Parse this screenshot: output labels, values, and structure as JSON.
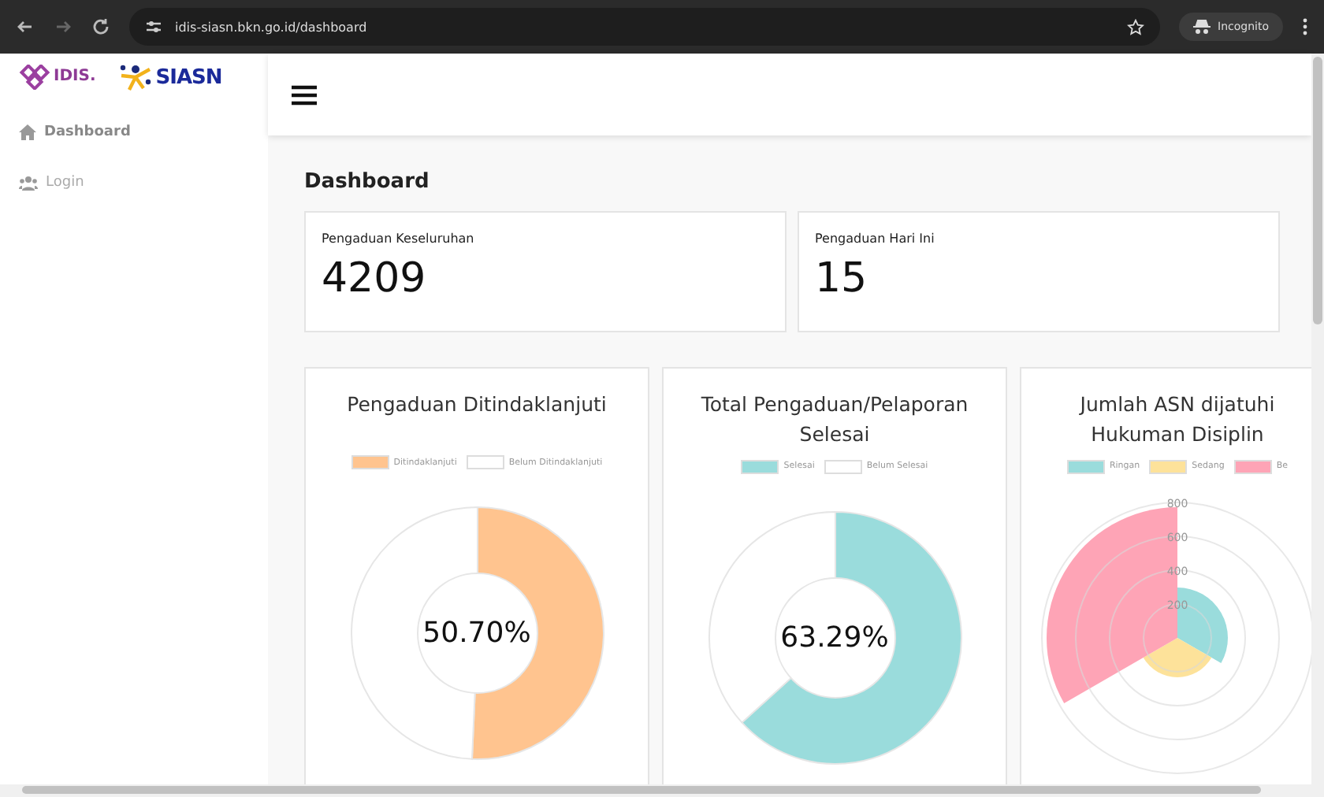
{
  "browser": {
    "url": "idis-siasn.bkn.go.id/dashboard",
    "profile": "Incognito"
  },
  "sidebar": {
    "logos": [
      {
        "text": "IDIS."
      },
      {
        "text": "SIASN"
      }
    ],
    "items": [
      {
        "label": "Dashboard",
        "selected": true
      },
      {
        "label": "Login",
        "selected": false
      }
    ]
  },
  "page_title": "Dashboard",
  "stats": [
    {
      "label": "Pengaduan Keseluruhan",
      "value": "4209"
    },
    {
      "label": "Pengaduan Hari Ini",
      "value": "15"
    }
  ],
  "charts": [
    {
      "title": "Pengaduan Ditindaklanjuti",
      "center": "50.70%",
      "chart_data": {
        "type": "donut",
        "legend": "top",
        "categories": [
          "Ditindaklanjuti",
          "Belum Ditindaklanjuti"
        ],
        "values": [
          50.7,
          49.3
        ]
      }
    },
    {
      "title": "Total Pengaduan/Pelaporan Selesai",
      "center": "63.29%",
      "chart_data": {
        "type": "donut",
        "legend": "top",
        "categories": [
          "Selesai",
          "Belum Selesai"
        ],
        "values": [
          63.29,
          36.71
        ]
      }
    }
  ],
  "polar_chart": {
    "title": "Jumlah ASN dijatuhi Hukuman Disiplin",
    "legend": [
      {
        "label": "Ringan",
        "color": "#9adcdc"
      },
      {
        "label": "Sedang",
        "color": "#fde29a"
      },
      {
        "label": "Be",
        "color": "#fea4b6"
      }
    ],
    "ticks": [
      "800",
      "600",
      "400",
      "200"
    ]
  }
}
